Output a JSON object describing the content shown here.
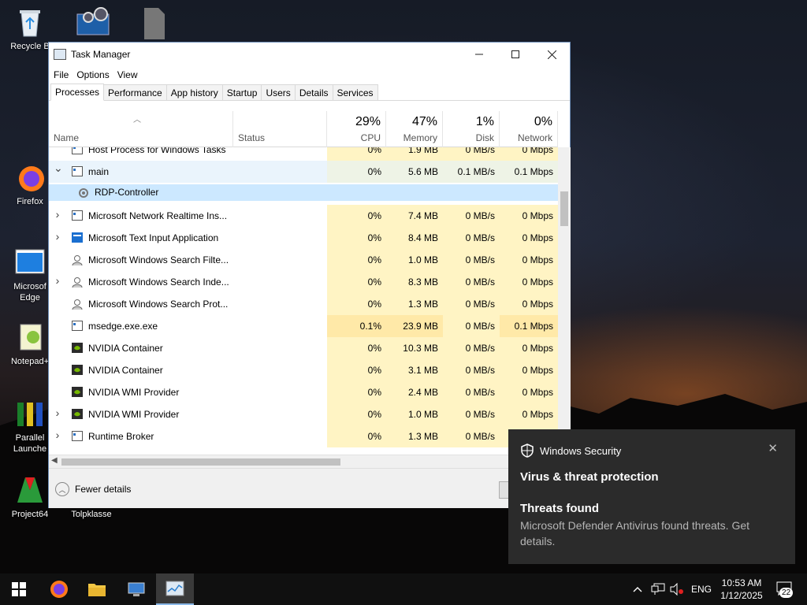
{
  "desktop": {
    "icons": [
      {
        "label": "Recycle B"
      },
      {
        "label": "Firefox"
      },
      {
        "label": "Microsof\nEdge"
      },
      {
        "label": "Notepad+"
      },
      {
        "label": "Parallel\nLaunche"
      },
      {
        "label": "Project64"
      },
      {
        "label": "Tolpklasse"
      }
    ]
  },
  "window": {
    "title": "Task Manager",
    "menu": [
      "File",
      "Options",
      "View"
    ],
    "tabs": [
      "Processes",
      "Performance",
      "App history",
      "Startup",
      "Users",
      "Details",
      "Services"
    ],
    "active_tab": "Processes",
    "columns": {
      "name": "Name",
      "status": "Status",
      "cpu": {
        "pct": "29%",
        "label": "CPU"
      },
      "memory": {
        "pct": "47%",
        "label": "Memory"
      },
      "disk": {
        "pct": "1%",
        "label": "Disk"
      },
      "network": {
        "pct": "0%",
        "label": "Network"
      }
    },
    "rows": [
      {
        "name": "Host Process for Windows Tasks",
        "expand": "",
        "cpu": "0%",
        "mem": "1.9 MB",
        "disk": "0 MB/s",
        "net": "0 Mbps",
        "icon": "window-icon"
      },
      {
        "name": "main",
        "expand": "v",
        "cpu": "0%",
        "mem": "5.6 MB",
        "disk": "0.1 MB/s",
        "net": "0.1 Mbps",
        "icon": "window-icon",
        "group": true
      },
      {
        "name": "RDP-Controller",
        "expand": "",
        "cpu": "",
        "mem": "",
        "disk": "",
        "net": "",
        "icon": "gear-icon",
        "child": true,
        "selected": true
      },
      {
        "name": "Microsoft Network Realtime Ins...",
        "expand": ">",
        "cpu": "0%",
        "mem": "7.4 MB",
        "disk": "0 MB/s",
        "net": "0 Mbps",
        "icon": "window-icon"
      },
      {
        "name": "Microsoft Text Input Application",
        "expand": ">",
        "cpu": "0%",
        "mem": "8.4 MB",
        "disk": "0 MB/s",
        "net": "0 Mbps",
        "icon": "blue-window-icon"
      },
      {
        "name": "Microsoft Windows Search Filte...",
        "expand": "",
        "cpu": "0%",
        "mem": "1.0 MB",
        "disk": "0 MB/s",
        "net": "0 Mbps",
        "icon": "search-person-icon"
      },
      {
        "name": "Microsoft Windows Search Inde...",
        "expand": ">",
        "cpu": "0%",
        "mem": "8.3 MB",
        "disk": "0 MB/s",
        "net": "0 Mbps",
        "icon": "search-person-icon"
      },
      {
        "name": "Microsoft Windows Search Prot...",
        "expand": "",
        "cpu": "0%",
        "mem": "1.3 MB",
        "disk": "0 MB/s",
        "net": "0 Mbps",
        "icon": "search-person-icon"
      },
      {
        "name": "msedge.exe.exe",
        "expand": "",
        "cpu": "0.1%",
        "mem": "23.9 MB",
        "disk": "0 MB/s",
        "net": "0.1 Mbps",
        "icon": "window-icon",
        "hi": true
      },
      {
        "name": "NVIDIA Container",
        "expand": "",
        "cpu": "0%",
        "mem": "10.3 MB",
        "disk": "0 MB/s",
        "net": "0 Mbps",
        "icon": "nvidia-icon"
      },
      {
        "name": "NVIDIA Container",
        "expand": "",
        "cpu": "0%",
        "mem": "3.1 MB",
        "disk": "0 MB/s",
        "net": "0 Mbps",
        "icon": "nvidia-icon"
      },
      {
        "name": "NVIDIA WMI Provider",
        "expand": "",
        "cpu": "0%",
        "mem": "2.4 MB",
        "disk": "0 MB/s",
        "net": "0 Mbps",
        "icon": "nvidia-icon"
      },
      {
        "name": "NVIDIA WMI Provider",
        "expand": ">",
        "cpu": "0%",
        "mem": "1.0 MB",
        "disk": "0 MB/s",
        "net": "0 Mbps",
        "icon": "nvidia-icon"
      },
      {
        "name": "Runtime Broker",
        "expand": ">",
        "cpu": "0%",
        "mem": "1.3 MB",
        "disk": "0 MB/s",
        "net": "0 Mbps",
        "icon": "window-icon"
      }
    ],
    "footer": {
      "fewer_details": "Fewer details"
    }
  },
  "toast": {
    "app": "Windows Security",
    "heading": "Virus & threat protection",
    "subheading": "Threats found",
    "body": "Microsoft Defender Antivirus found threats. Get details."
  },
  "taskbar": {
    "language": "ENG",
    "time": "10:53 AM",
    "date": "1/12/2025",
    "notifications_count": "22"
  },
  "colors": {
    "heat_light": "#fff4c4",
    "heat_medium": "#ffe9a8",
    "selection": "#cce8ff",
    "toast_bg": "#2b2b2b",
    "taskbar_bg": "#101010"
  }
}
